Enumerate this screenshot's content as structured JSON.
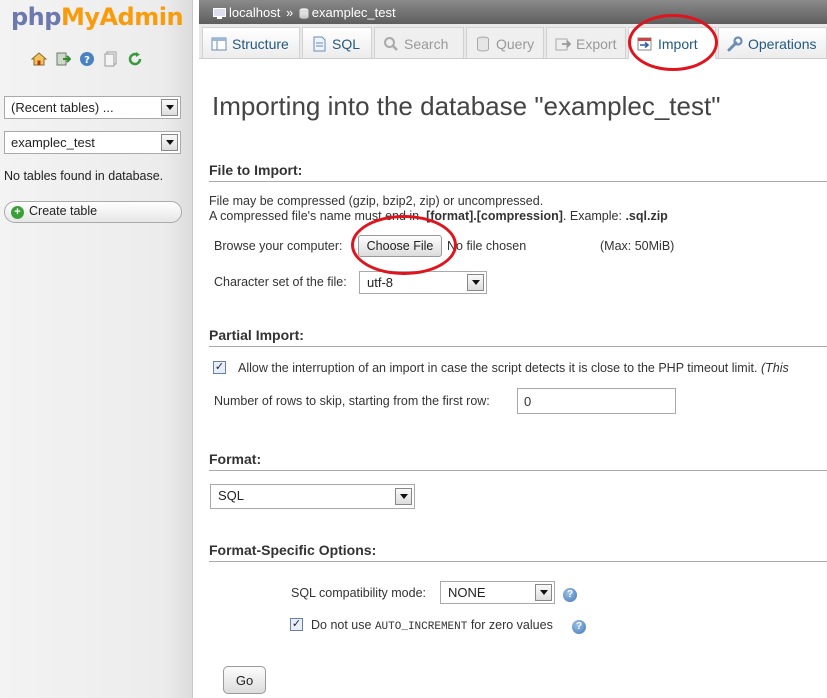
{
  "app": {
    "logo_php": "php",
    "logo_myadmin": "MyAdmin",
    "colors": {
      "logo_php": "#6c78af",
      "logo_myadmin": "#f89c0e",
      "link": "#235a81",
      "annotation": "#e0141d"
    }
  },
  "sidebar": {
    "nav_icons": [
      "home-icon",
      "exit-icon",
      "help-icon",
      "docs-icon",
      "reload-icon"
    ],
    "recent_tables": "(Recent tables) ...",
    "database_select": "examplec_test",
    "no_tables": "No tables found in database.",
    "create_table": "Create table"
  },
  "breadcrumb": {
    "server": "localhost",
    "separator": "»",
    "database": "examplec_test"
  },
  "tabs": [
    {
      "label": "Structure",
      "icon": "structure-icon",
      "state": "enabled"
    },
    {
      "label": "SQL",
      "icon": "sql-icon",
      "state": "enabled"
    },
    {
      "label": "Search",
      "icon": "search-icon",
      "state": "disabled"
    },
    {
      "label": "Query",
      "icon": "query-icon",
      "state": "disabled"
    },
    {
      "label": "Export",
      "icon": "export-icon",
      "state": "disabled"
    },
    {
      "label": "Import",
      "icon": "import-icon",
      "state": "active"
    },
    {
      "label": "Operations",
      "icon": "operations-icon",
      "state": "enabled"
    }
  ],
  "main": {
    "title": "Importing into the database \"examplec_test\"",
    "file_section": {
      "heading": "File to Import:",
      "compress_note": "File may be compressed (gzip, bzip2, zip) or uncompressed.",
      "name_note_prefix": "A compressed file's name must end in ",
      "name_note_pattern": ".[format].[compression]",
      "name_note_mid": ". Example: ",
      "name_note_example": ".sql.zip",
      "browse_label": "Browse your computer:",
      "choose_file": "Choose File",
      "no_file": "No file chosen",
      "max_size": "(Max: 50MiB)",
      "charset_label": "Character set of the file:",
      "charset_value": "utf-8"
    },
    "partial_section": {
      "heading": "Partial Import:",
      "allow_interrupt": "Allow the interruption of an import in case the script detects it is close to the PHP timeout limit.",
      "allow_interrupt_cont": "(This",
      "allow_interrupt_checked": true,
      "skip_label": "Number of rows to skip, starting from the first row:",
      "skip_value": "0"
    },
    "format_section": {
      "heading": "Format:",
      "format_value": "SQL"
    },
    "options_section": {
      "heading": "Format-Specific Options:",
      "compat_label": "SQL compatibility mode:",
      "compat_value": "NONE",
      "auto_inc_prefix": "Do not use ",
      "auto_inc_code": "AUTO_INCREMENT",
      "auto_inc_suffix": " for zero values",
      "auto_inc_checked": true
    },
    "go_button": "Go"
  }
}
